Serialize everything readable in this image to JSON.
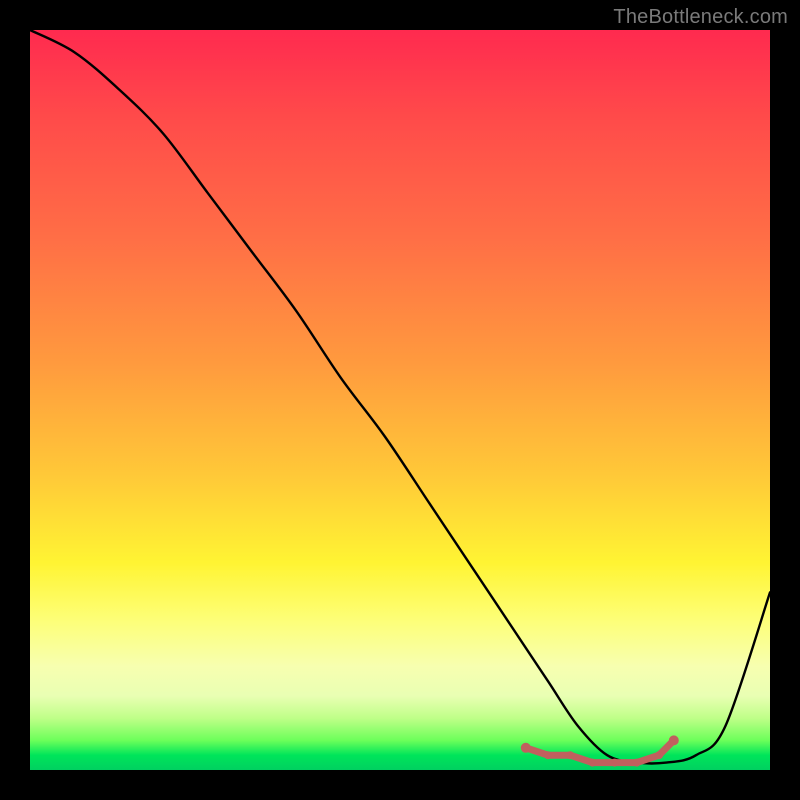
{
  "watermark": "TheBottleneck.com",
  "chart_data": {
    "type": "line",
    "title": "",
    "xlabel": "",
    "ylabel": "",
    "xlim": [
      0,
      100
    ],
    "ylim": [
      0,
      100
    ],
    "series": [
      {
        "name": "curve",
        "x": [
          0,
          6,
          12,
          18,
          24,
          30,
          36,
          42,
          48,
          54,
          60,
          66,
          70,
          74,
          78,
          82,
          86,
          90,
          94,
          100
        ],
        "y": [
          100,
          97,
          92,
          86,
          78,
          70,
          62,
          53,
          45,
          36,
          27,
          18,
          12,
          6,
          2,
          1,
          1,
          2,
          6,
          24
        ]
      },
      {
        "name": "highlight-dots",
        "x": [
          67,
          70,
          73,
          76,
          79,
          82,
          85,
          87
        ],
        "y": [
          3,
          2,
          2,
          1,
          1,
          1,
          2,
          4
        ]
      }
    ],
    "colors": {
      "curve": "#000000",
      "dots": "#c0605e",
      "gradient_top": "#ff2a4f",
      "gradient_mid": "#fff433",
      "gradient_bottom": "#00d060"
    }
  }
}
